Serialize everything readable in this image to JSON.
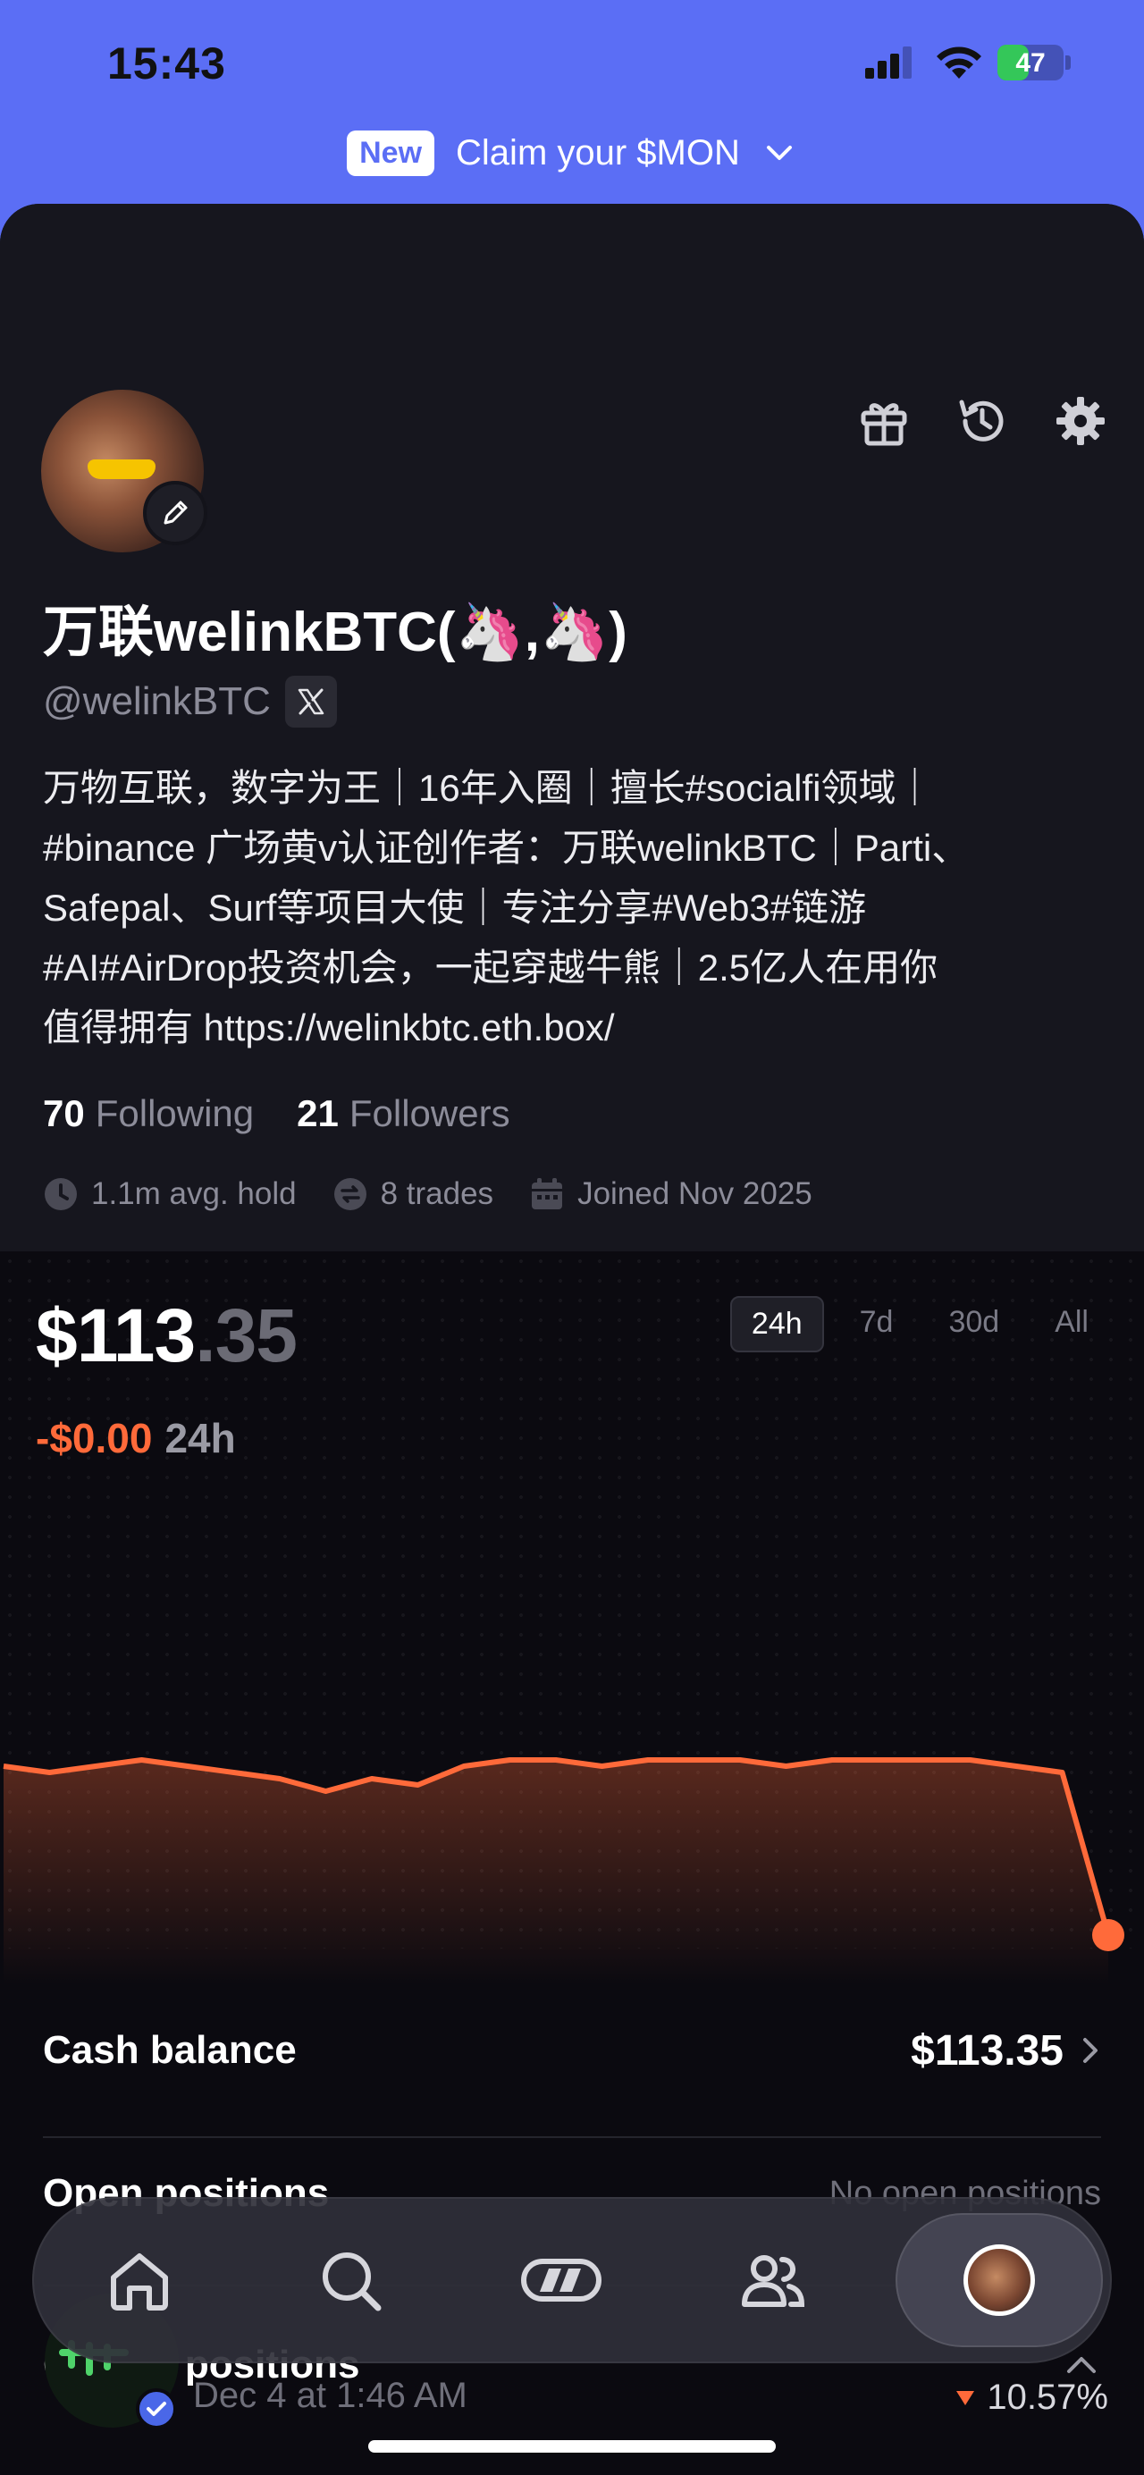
{
  "status_bar": {
    "time": "15:43",
    "battery": "47",
    "battery_level": 0.47
  },
  "promo": {
    "badge": "New",
    "text": "Claim your $MON"
  },
  "profile": {
    "display_name": "万联welinkBTC(🦄,🦄)",
    "handle": "@welinkBTC",
    "bio_lines": [
      "万物互联，数字为王｜16年入圈｜擅长#socialfi领域｜",
      "#binance 广场黄v认证创作者：万联welinkBTC｜Parti、",
      "Safepal、Surf等项目大使｜专注分享#Web3#链游",
      "#AI#AirDrop投资机会，一起穿越牛熊｜2.5亿人在用你",
      "值得拥有 https://welinkbtc.eth.box/"
    ],
    "following_count": "70",
    "following_label": "Following",
    "followers_count": "21",
    "followers_label": "Followers",
    "avg_hold": "1.1m avg. hold",
    "trades": "8 trades",
    "joined": "Joined Nov 2025"
  },
  "portfolio": {
    "balance_main": "$113",
    "balance_cents": ".35",
    "change": "-$0.00",
    "change_period": "24h",
    "ranges": [
      "24h",
      "7d",
      "30d",
      "All"
    ],
    "active_range": "24h",
    "line_color": "#ff6a3a"
  },
  "chart_data": {
    "type": "area",
    "x": [
      0,
      1,
      2,
      3,
      4,
      5,
      6,
      7,
      8,
      9,
      10,
      11,
      12,
      13,
      14,
      15,
      16,
      17,
      18,
      19,
      20,
      21,
      22,
      23,
      24
    ],
    "series": [
      {
        "values": [
          113.62,
          113.61,
          113.62,
          113.63,
          113.62,
          113.61,
          113.6,
          113.58,
          113.6,
          113.59,
          113.62,
          113.63,
          113.63,
          113.62,
          113.63,
          113.63,
          113.63,
          113.62,
          113.63,
          113.63,
          113.63,
          113.63,
          113.62,
          113.61,
          113.35
        ]
      }
    ],
    "xlabel": "",
    "ylabel": "",
    "ylim": [
      113.3,
      113.7
    ],
    "grid": false
  },
  "sections": {
    "cash_label": "Cash balance",
    "cash_value": "$113.35",
    "open_label": "Open positions",
    "open_value": "No open positions",
    "closed_label": "Closed positions"
  },
  "closed_item": {
    "date": "Dec 4 at 1:46 AM",
    "pct": "10.57%"
  },
  "nav": {
    "items": [
      "home-icon",
      "search-icon",
      "trade-icon",
      "people-icon",
      "profile-avatar"
    ],
    "active": "profile-avatar"
  }
}
